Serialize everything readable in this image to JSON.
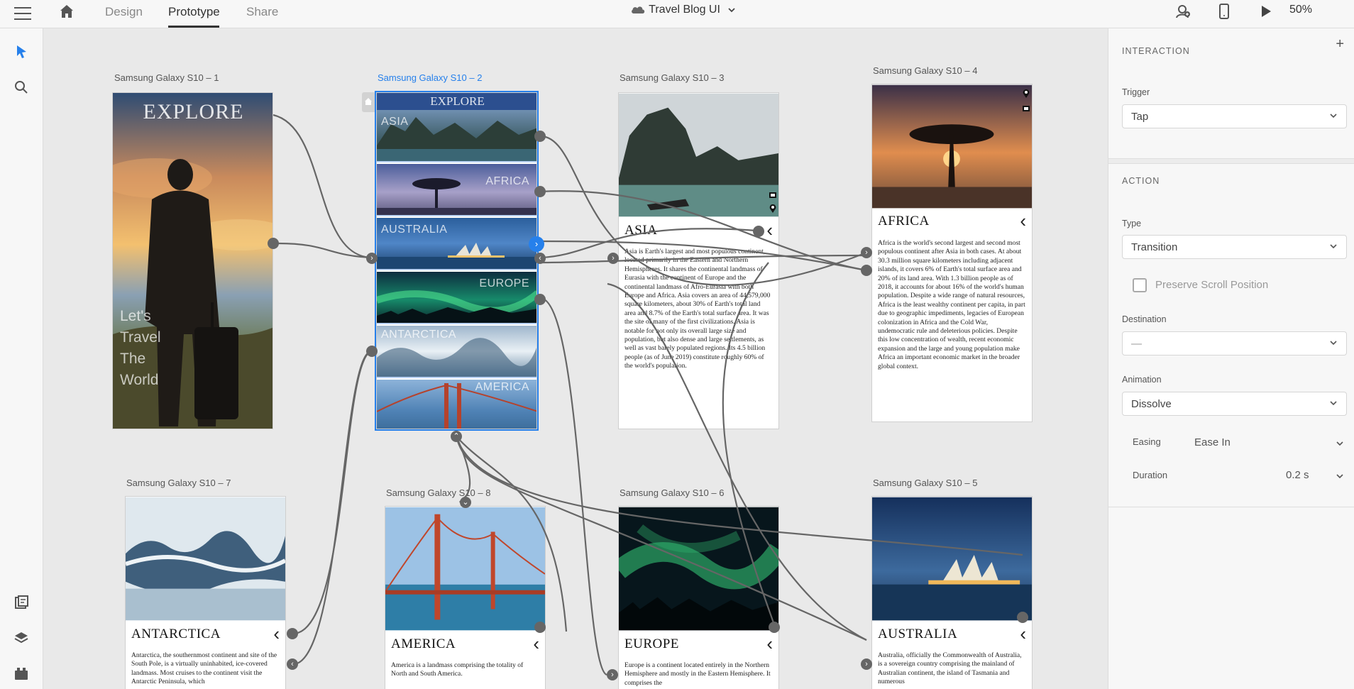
{
  "topbar": {
    "tabs": [
      "Design",
      "Prototype",
      "Share"
    ],
    "active_tab": "Prototype",
    "document_title": "Travel Blog UI",
    "zoom": "50%"
  },
  "canvas": {
    "artboards": {
      "s1": {
        "label": "Samsung Galaxy S10 – 1",
        "heading": "EXPLORE",
        "tagline": [
          "Let's",
          "Travel",
          "The",
          "World"
        ]
      },
      "s2": {
        "label": "Samsung Galaxy S10 – 2",
        "heading": "EXPLORE",
        "strips": [
          "ASIA",
          "AFRICA",
          "AUSTRALIA",
          "EUROPE",
          "ANTARCTICA",
          "AMERICA"
        ]
      },
      "s3": {
        "label": "Samsung Galaxy S10 – 3",
        "title": "ASIA",
        "body": "Asia is Earth's largest and most populous continent, located primarily in the Eastern and Northern Hemispheres. It shares the continental landmass of Eurasia with the continent of Europe and the continental landmass of Afro-Eurasia with both Europe and Africa. Asia covers an area of 44,579,000 square kilometers, about 30% of Earth's total land area and 8.7% of the Earth's total surface area. It was the site of many of the first civilizations. Asia is notable for not only its overall large size and population, but also dense and large settlements, as well as vast barely populated regions. Its 4.5 billion people (as of June 2019) constitute roughly 60% of the world's population."
      },
      "s4": {
        "label": "Samsung Galaxy S10 – 4",
        "title": "AFRICA",
        "body": "Africa is the world's second largest and second most populous continent after Asia in both cases. At about 30.3 million square kilometers including adjacent islands, it covers 6% of Earth's total surface area and 20% of its land area. With 1.3 billion people as of 2018, it accounts for about 16% of the world's human population. Despite a wide range of natural resources, Africa is the least wealthy continent per capita, in part due to geographic impediments, legacies of European colonization in Africa and the Cold War, undemocratic rule and deleterious policies. Despite this low concentration of wealth, recent economic expansion and the large and young population make Africa an important economic market in the broader global context."
      },
      "s5": {
        "label": "Samsung Galaxy S10 – 5",
        "title": "AUSTRALIA",
        "body": "Australia, officially the Commonwealth of Australia, is a sovereign country comprising the mainland of Australian continent, the island of Tasmania and numerous"
      },
      "s6": {
        "label": "Samsung Galaxy S10 – 6",
        "title": "EUROPE",
        "body": "Europe is a continent located entirely in the Northern Hemisphere and mostly in the Eastern Hemisphere. It comprises the"
      },
      "s7": {
        "label": "Samsung Galaxy S10 – 7",
        "title": "ANTARCTICA",
        "body": "Antarctica, the southernmost continent and site of the South Pole, is a virtually uninhabited, ice-covered landmass. Most cruises to the continent visit the Antarctic Peninsula, which"
      },
      "s8": {
        "label": "Samsung Galaxy S10 – 8",
        "title": "AMERICA",
        "body": "America is a landmass comprising the totality of North and South America."
      }
    }
  },
  "panel": {
    "interaction_title": "INTERACTION",
    "trigger_label": "Trigger",
    "trigger_value": "Tap",
    "action_title": "ACTION",
    "type_label": "Type",
    "type_value": "Transition",
    "preserve_scroll_label": "Preserve Scroll Position",
    "destination_label": "Destination",
    "destination_value": "—",
    "animation_label": "Animation",
    "animation_value": "Dissolve",
    "easing_label": "Easing",
    "easing_value": "Ease In",
    "duration_label": "Duration",
    "duration_value": "0.2 s"
  },
  "colors": {
    "accent": "#2680eb",
    "wire": "#666666",
    "panel_bg": "#f7f7f7",
    "canvas_bg": "#e9e9e9"
  },
  "icons": [
    "hamburger-menu-icon",
    "home-icon",
    "cloud-icon",
    "chevron-down-icon",
    "user-share-icon",
    "device-preview-icon",
    "play-icon",
    "select-arrow-icon",
    "search-icon",
    "assets-icon",
    "layers-icon",
    "plugins-icon",
    "plus-icon",
    "map-pin-icon",
    "gallery-icon",
    "back-chevron-icon"
  ]
}
